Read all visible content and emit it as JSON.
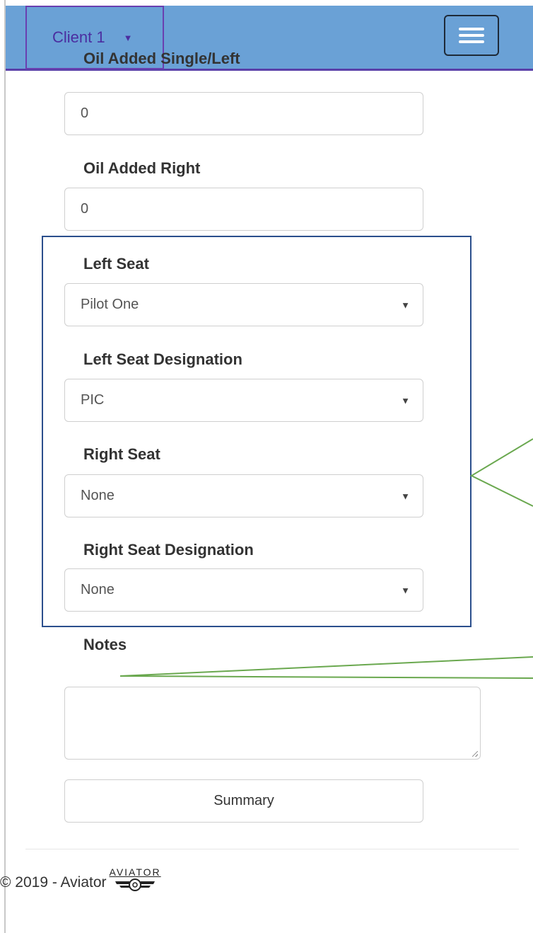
{
  "header": {
    "client_label": "Client 1",
    "caret": "▼",
    "menu_icon": "hamburger-icon"
  },
  "form": {
    "oil_added_single_left": {
      "label": "Oil Added Single/Left",
      "value": "0"
    },
    "oil_added_right": {
      "label": "Oil Added Right",
      "value": "0"
    },
    "left_seat": {
      "label": "Left Seat",
      "value": "Pilot One"
    },
    "left_seat_designation": {
      "label": "Left Seat Designation",
      "value": "PIC"
    },
    "right_seat": {
      "label": "Right Seat",
      "value": "None"
    },
    "right_seat_designation": {
      "label": "Right Seat Designation",
      "value": "None"
    },
    "notes": {
      "label": "Notes",
      "value": ""
    },
    "select_caret": "▼",
    "summary_label": "Summary"
  },
  "footer": {
    "copyright": "© 2019 - Aviator",
    "logo_text": "AVIATOR"
  },
  "colors": {
    "navbar": "#6aa1d6",
    "client_accent": "#4b2ea0",
    "box_border": "#2b4f8c",
    "annotation": "#6aa84f"
  }
}
